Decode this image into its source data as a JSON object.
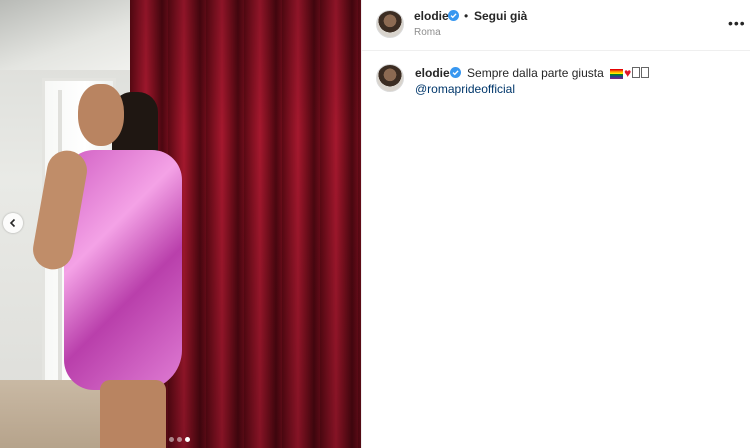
{
  "post": {
    "author": {
      "username": "elodie",
      "verified": true,
      "location": "Roma"
    },
    "follow_separator": "•",
    "follow_status": "Segui già",
    "more_icon": "•••",
    "carousel": {
      "total_slides": 3,
      "current_slide": 3,
      "nav_icon": "chevron-left-icon"
    }
  },
  "caption": {
    "username": "elodie",
    "verified": true,
    "text": "Sempre dalla parte giusta",
    "emojis": [
      "rainbow-flag",
      "red-heart",
      "unrendered-glyph",
      "unrendered-glyph"
    ],
    "mention": "@romaprideofficial"
  },
  "colors": {
    "verified_badge": "#3897f0",
    "link": "#00376b",
    "text": "#262626",
    "secondary_text": "#8e8e8e"
  }
}
